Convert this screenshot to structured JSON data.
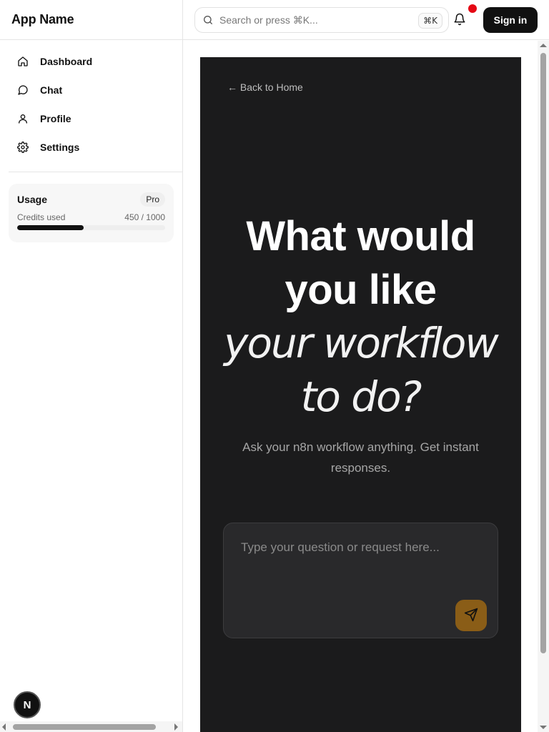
{
  "sidebar": {
    "app_name": "App Name",
    "nav": [
      {
        "label": "Dashboard",
        "icon": "home-icon"
      },
      {
        "label": "Chat",
        "icon": "chat-icon"
      },
      {
        "label": "Profile",
        "icon": "user-icon"
      },
      {
        "label": "Settings",
        "icon": "gear-icon"
      }
    ],
    "usage": {
      "title": "Usage",
      "plan": "Pro",
      "credits_label": "Credits used",
      "credits_value": "450 / 1000",
      "progress_fraction": 0.45
    },
    "avatar_letter": "N"
  },
  "topbar": {
    "search_placeholder": "Search or press ⌘K...",
    "shortcut": "⌘K",
    "sign_in": "Sign in",
    "notification_dot_color": "#e50914"
  },
  "hero": {
    "back_link": "← Back to Home",
    "headline_line1": "What would",
    "headline_line2": "you like",
    "headline_line3": "your workflow",
    "headline_line4": "to do?",
    "subtitle": "Ask your n8n workflow anything. Get instant responses.",
    "input_placeholder": "Type your question or request here...",
    "accent_color": "#8a5d17",
    "background_color": "#1b1b1c"
  }
}
